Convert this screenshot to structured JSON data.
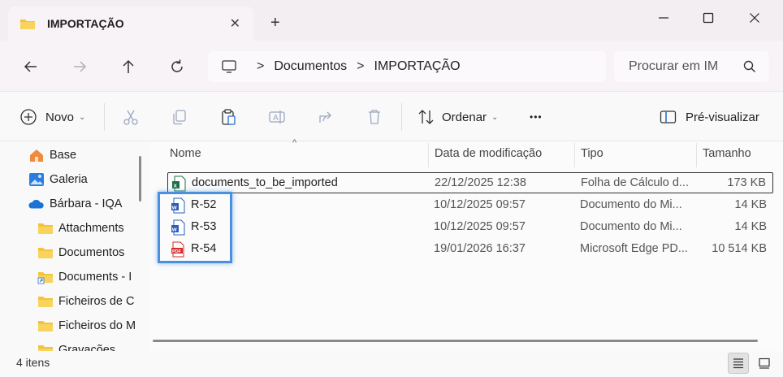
{
  "tab": {
    "title": "IMPORTAÇÃO",
    "close_glyph": "✕",
    "new_tab_glyph": "+"
  },
  "window": {
    "minimize_glyph": "—",
    "maximize_glyph": "☐",
    "close_glyph": "✕"
  },
  "nav": {
    "back_icon": "arrow-left-icon",
    "forward_icon": "arrow-right-icon",
    "up_icon": "arrow-up-icon",
    "refresh_icon": "refresh-icon"
  },
  "address": {
    "crumbs": [
      "Documentos",
      "IMPORTAÇÃO"
    ],
    "separator": ">"
  },
  "search": {
    "placeholder": "Procurar em IM"
  },
  "toolbar": {
    "new_label": "Novo",
    "sort_label": "Ordenar",
    "more_glyph": "•••",
    "preview_label": "Pré-visualizar"
  },
  "sidebar": {
    "items": [
      {
        "label": "Base",
        "icon": "home-icon"
      },
      {
        "label": "Galeria",
        "icon": "gallery-icon"
      },
      {
        "label": "Bárbara - IQA",
        "icon": "onedrive-cloud-icon"
      },
      {
        "label": "Attachments",
        "icon": "folder-icon"
      },
      {
        "label": "Documentos",
        "icon": "folder-icon"
      },
      {
        "label": "Documents - I",
        "icon": "folder-shortcut-icon"
      },
      {
        "label": "Ficheiros de C",
        "icon": "folder-icon"
      },
      {
        "label": "Ficheiros do M",
        "icon": "folder-icon"
      },
      {
        "label": "Gravações",
        "icon": "folder-icon"
      }
    ]
  },
  "columns": {
    "name": "Nome",
    "modified": "Data de modificação",
    "type": "Tipo",
    "size": "Tamanho"
  },
  "files": [
    {
      "name": "documents_to_be_imported",
      "modified": "22/12/2025 12:38",
      "type": "Folha de Cálculo d...",
      "size": "173 KB",
      "icon": "excel-file-icon"
    },
    {
      "name": "R-52",
      "modified": "10/12/2025 09:57",
      "type": "Documento do Mi...",
      "size": "14 KB",
      "icon": "word-file-icon"
    },
    {
      "name": "R-53",
      "modified": "10/12/2025 09:57",
      "type": "Documento do Mi...",
      "size": "14 KB",
      "icon": "word-file-icon"
    },
    {
      "name": "R-54",
      "modified": "19/01/2026 16:37",
      "type": "Microsoft Edge PD...",
      "size": "10 514 KB",
      "icon": "pdf-file-icon"
    }
  ],
  "status": {
    "count": "4 itens"
  },
  "colors": {
    "selection_highlight": "#4a8fe0",
    "excel_green": "#1d7044",
    "word_blue": "#2b5eb8",
    "pdf_red": "#d42a2a",
    "folder_yellow": "#f5c33b"
  }
}
